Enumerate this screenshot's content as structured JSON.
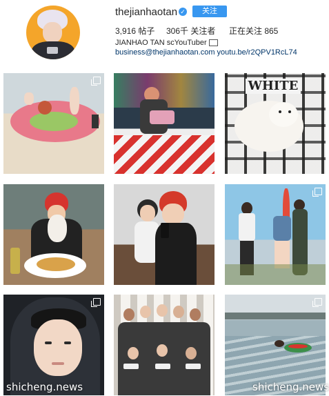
{
  "profile": {
    "username": "thejianhaotan",
    "follow_label": "关注",
    "stats": {
      "posts": "3,916 帖子",
      "followers": "306千 关注者",
      "following": "正在关注 865"
    },
    "bio_name": "JIANHAO TAN",
    "bio_tag": "scYouTuber",
    "email": "business@thejianhaotan.com",
    "link": "youtu.be/r2QPV1RcL74"
  },
  "grid": {
    "posts": [
      {
        "scene": "beach-watermelon-float",
        "multi": true
      },
      {
        "scene": "arcade-claw-machine",
        "multi": false
      },
      {
        "scene": "pomeranian-white-pillow",
        "multi": false
      },
      {
        "scene": "dog-dinner-table",
        "multi": false
      },
      {
        "scene": "mirror-selfie-friends",
        "multi": false
      },
      {
        "scene": "rooftop-group-dance",
        "multi": true
      },
      {
        "scene": "hooded-selfie",
        "multi": true
      },
      {
        "scene": "youtube-group-photo",
        "multi": false
      },
      {
        "scene": "sea-float",
        "multi": true
      }
    ]
  },
  "watermarks": {
    "left": "shicheng.news",
    "right": "shicheng.news"
  }
}
